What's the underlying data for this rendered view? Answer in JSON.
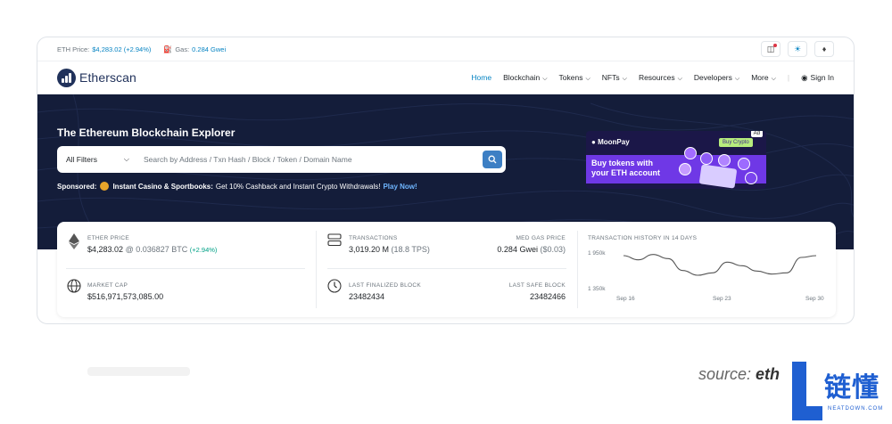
{
  "topbar": {
    "eth_price_label": "ETH Price:",
    "eth_price_value": "$4,283.02 (+2.94%)",
    "gas_label": "Gas:",
    "gas_value": "0.284 Gwei"
  },
  "brand": {
    "name": "Etherscan"
  },
  "nav": {
    "home": "Home",
    "blockchain": "Blockchain",
    "tokens": "Tokens",
    "nfts": "NFTs",
    "resources": "Resources",
    "developers": "Developers",
    "more": "More",
    "signin": "Sign In"
  },
  "hero": {
    "title": "The Ethereum Blockchain Explorer",
    "filter": "All Filters",
    "search_placeholder": "Search by Address / Txn Hash / Block / Token / Domain Name",
    "sponsor_label": "Sponsored:",
    "sponsor_name": "Instant Casino & Sportbooks:",
    "sponsor_text": "Get 10% Cashback and Instant Crypto Withdrawals!",
    "sponsor_link": "Play Now!"
  },
  "ad": {
    "tag": "Ad",
    "brand": "MoonPay",
    "button": "Buy Crypto",
    "line1": "Buy tokens with",
    "line2": "your ETH account"
  },
  "stats": {
    "ether_price_label": "ETHER PRICE",
    "ether_price_value": "$4,283.02",
    "ether_price_btc": "@ 0.036827 BTC",
    "ether_price_change": "(+2.94%)",
    "market_cap_label": "MARKET CAP",
    "market_cap_value": "$516,971,573,085.00",
    "transactions_label": "TRANSACTIONS",
    "transactions_value": "3,019.20 M",
    "transactions_tps": "(18.8 TPS)",
    "med_gas_label": "MED GAS PRICE",
    "med_gas_value": "0.284 Gwei",
    "med_gas_usd": "($0.03)",
    "last_finalized_label": "LAST FINALIZED BLOCK",
    "last_finalized_value": "23482434",
    "last_safe_label": "LAST SAFE BLOCK",
    "last_safe_value": "23482466"
  },
  "chart_data": {
    "type": "line",
    "title": "TRANSACTION HISTORY IN 14 DAYS",
    "y_tick_labels": [
      "1 950k",
      "1 350k"
    ],
    "x_tick_labels": [
      "Sep 16",
      "Sep 23",
      "Sep 30"
    ],
    "ylim": [
      1350,
      1950
    ],
    "values": [
      1890,
      1820,
      1910,
      1840,
      1640,
      1560,
      1600,
      1780,
      1720,
      1630,
      1580,
      1600,
      1860,
      1890
    ]
  },
  "caption": {
    "source_prefix": "source:",
    "source_name": "eth"
  },
  "watermark": {
    "cn": "链懂",
    "en": "NEATDOWN.COM"
  },
  "colors": {
    "brand_blue": "#0784c3",
    "hero_bg": "#141d3a",
    "navy": "#21325b"
  }
}
